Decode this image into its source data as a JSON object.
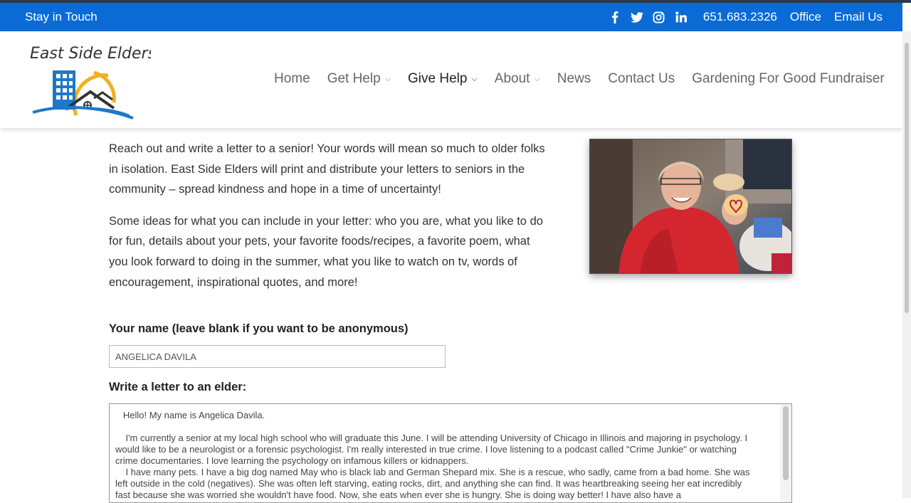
{
  "topbar": {
    "stay_in_touch": "Stay in Touch",
    "social": [
      "facebook-icon",
      "twitter-icon",
      "instagram-icon",
      "linkedin-icon"
    ],
    "phone": "651.683.2326",
    "office": "Office",
    "email": "Email Us",
    "color": "#0a6bd6"
  },
  "logo": {
    "text": "East Side Elders",
    "colors": {
      "building": "#1e78c8",
      "sun": "#f0b020",
      "wave": "#1e78c8"
    }
  },
  "nav": {
    "items": [
      {
        "label": "Home",
        "dropdown": false,
        "active": false
      },
      {
        "label": "Get Help",
        "dropdown": true,
        "active": false
      },
      {
        "label": "Give Help",
        "dropdown": true,
        "active": true
      },
      {
        "label": "About",
        "dropdown": true,
        "active": false
      },
      {
        "label": "News",
        "dropdown": false,
        "active": false
      },
      {
        "label": "Contact Us",
        "dropdown": false,
        "active": false
      },
      {
        "label": "Gardening For Good Fundraiser",
        "dropdown": false,
        "active": false
      }
    ]
  },
  "main": {
    "para1": "Reach out and write a letter to a senior!  Your words will mean so much to older folks in isolation.  East Side Elders will print and distribute your letters to seniors in the community – spread kindness and hope in a time of uncertainty!",
    "para2": "Some ideas for what you can include in your letter:  who you are, what you like to do for fun, details about your pets, your favorite foods/recipes, a favorite poem, what you look forward to doing in the summer, what you like to watch on tv, words of encouragement, inspirational quotes, and more!"
  },
  "form": {
    "name_label": "Your name (leave blank if you want to be anonymous)",
    "name_value": "ANGELICA DAVILA",
    "letter_label": "Write a letter to an elder:",
    "letter_value": "   Hello! My name is Angelica Davila.\n\n    I'm currently a senior at my local high school who will graduate this June. I will be attending University of Chicago in Illinois and majoring in psychology. I would like to be a neurologist or a forensic psychologist. I'm really interested in true crime. I love listening to a podcast called \"Crime Junkie\" or watching crime documentaries. I love learning the psychology on infamous killers or kidnappers.\n    I have many pets. I have a big dog named May who is black lab and German Shepard mix. She is a rescue, who sadly, came from a bad home. She was left outside in the cold (negatives). She was often left starving, eating rocks, dirt, and anything she can find. It was heartbreaking seeing her eat incredibly fast because she was worried she wouldn't have food. Now, she eats when ever she is hungry. She is doing way better! I have also have a"
  }
}
